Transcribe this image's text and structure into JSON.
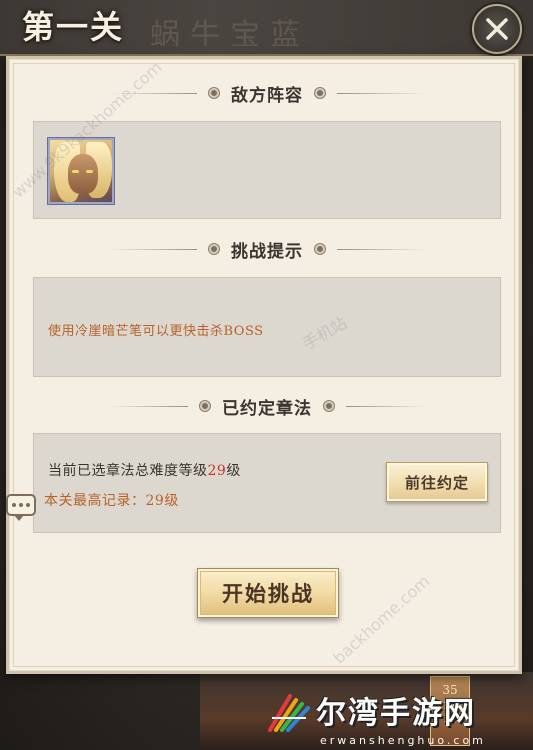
{
  "stage": {
    "title": "第一关",
    "title_background": "蜗牛宝蓝"
  },
  "enemy_section": {
    "header": "敌方阵容"
  },
  "hint_section": {
    "header": "挑战提示",
    "hint": "使用冷崖暗芒笔可以更快击杀BOSS"
  },
  "pact_section": {
    "header": "已约定章法",
    "difficulty_prefix": "当前已选章法总难度等级",
    "difficulty_level": "29",
    "difficulty_suffix": "级",
    "record": "本关最高记录：29级",
    "goto_button": "前往约定"
  },
  "start_button": "开始挑战",
  "background_badge": "35\n级\n难",
  "watermark": {
    "site": "www.9k9kackhome.com",
    "site2": "backhome.com",
    "faint": "手机站"
  },
  "logo": {
    "name": "尔湾手游网",
    "sub": "erwanshenghuo.com"
  },
  "colors": {
    "panel": "#f4eee3",
    "box": "#ddd8cf",
    "accent_orange": "#b7622a",
    "accent_red": "#c4322a",
    "button_gold": "#f2daa3"
  }
}
